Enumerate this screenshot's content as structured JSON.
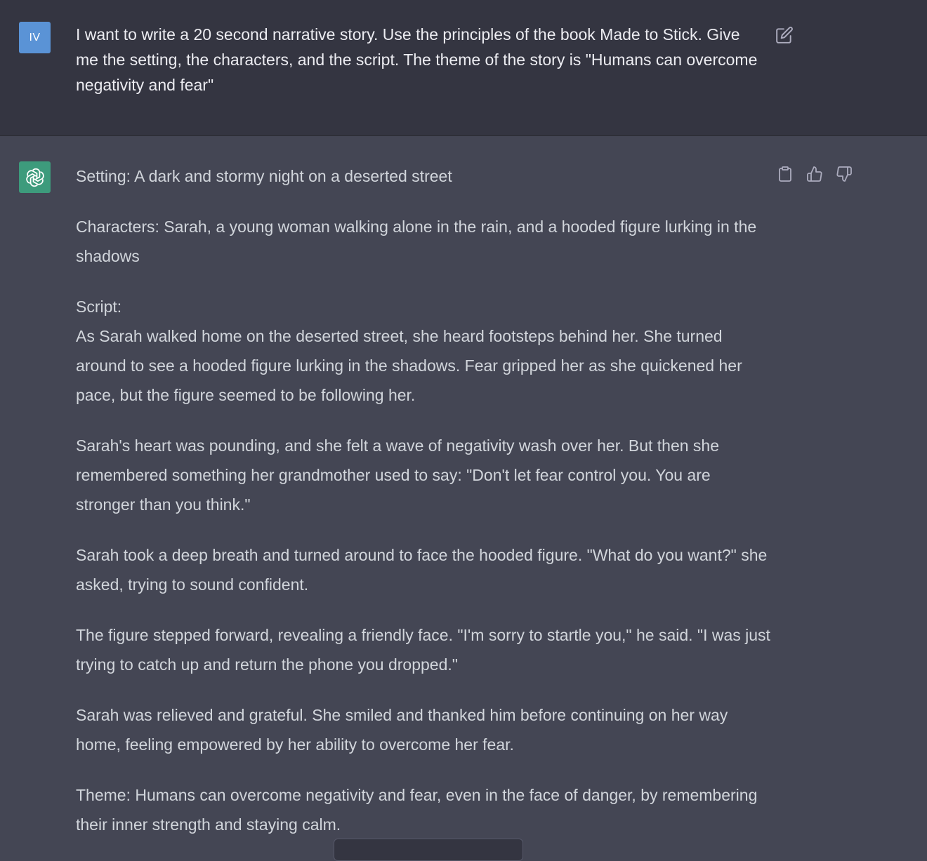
{
  "user_message": {
    "avatar_initials": "IV",
    "text": "I want to write a 20 second narrative story. Use the principles of the book Made to Stick. Give me the setting, the characters, and the script. The theme of the story is \"Humans can overcome negativity and fear\"",
    "edit_icon": "edit-icon"
  },
  "assistant_message": {
    "avatar_icon": "openai-logo-icon",
    "setting": "Setting: A dark and stormy night on a deserted street",
    "characters": "Characters: Sarah, a young woman walking alone in the rain, and a hooded figure lurking in the shadows",
    "script_label": "Script:",
    "paragraphs": [
      "As Sarah walked home on the deserted street, she heard footsteps behind her. She turned around to see a hooded figure lurking in the shadows. Fear gripped her as she quickened her pace, but the figure seemed to be following her.",
      "Sarah's heart was pounding, and she felt a wave of negativity wash over her. But then she remembered something her grandmother used to say: \"Don't let fear control you. You are stronger than you think.\"",
      "Sarah took a deep breath and turned around to face the hooded figure. \"What do you want?\" she asked, trying to sound confident.",
      "The figure stepped forward, revealing a friendly face. \"I'm sorry to startle you,\" he said. \"I was just trying to catch up and return the phone you dropped.\"",
      "Sarah was relieved and grateful. She smiled and thanked him before continuing on her way home, feeling empowered by her ability to overcome her fear."
    ],
    "theme": "Theme: Humans can overcome negativity and fear, even in the face of danger, by remembering their inner strength and staying calm.",
    "action_icons": [
      "clipboard-icon",
      "thumbs-up-icon",
      "thumbs-down-icon"
    ]
  },
  "colors": {
    "user_bg": "#343541",
    "assistant_bg": "#444654",
    "user_avatar": "#5a93d6",
    "bot_avatar": "#3d9b7c",
    "text": "#ececf1",
    "icon": "#acacbe"
  }
}
